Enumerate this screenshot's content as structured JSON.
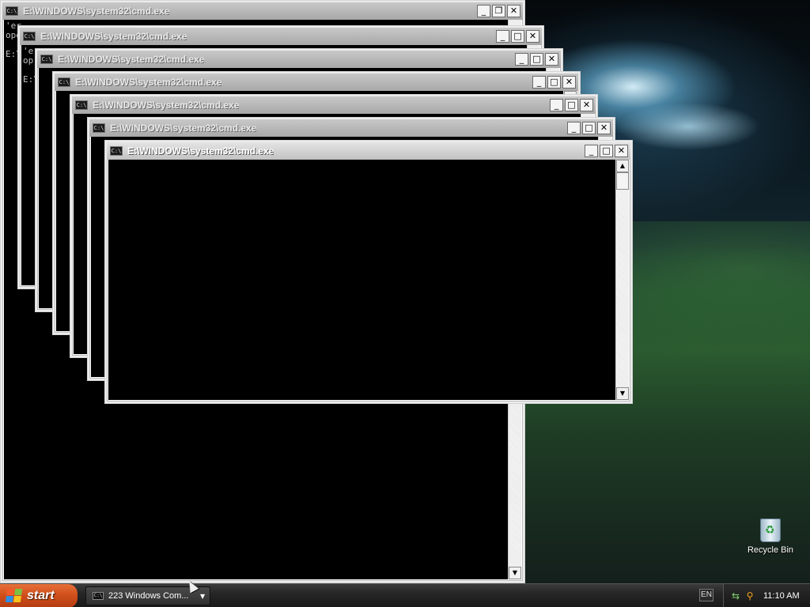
{
  "windows": [
    {
      "title": "E:\\WINDOWS\\system32\\cmd.exe",
      "console_text": "'er\nope\n\nE:\\"
    },
    {
      "title": "E:\\WINDOWS\\system32\\cmd.exe",
      "console_text": "'e\nop\n\nE:\\Do"
    },
    {
      "title": "E:\\WINDOWS\\system32\\cmd.exe",
      "console_text": ""
    },
    {
      "title": "E:\\WINDOWS\\system32\\cmd.exe",
      "console_text": ""
    },
    {
      "title": "E:\\WINDOWS\\system32\\cmd.exe",
      "console_text": ""
    },
    {
      "title": "E:\\WINDOWS\\system32\\cmd.exe",
      "console_text": ""
    },
    {
      "title": "E:\\WINDOWS\\system32\\cmd.exe",
      "console_text": ""
    }
  ],
  "window_controls": {
    "minimize": "_",
    "maximize": "□",
    "restore": "❐",
    "close": "✕",
    "scroll_up": "▲",
    "scroll_down": "▼"
  },
  "desktop": {
    "recycle_bin_label": "Recycle Bin"
  },
  "taskbar": {
    "start_label": "start",
    "task_button_label": "223 Windows Com...",
    "task_icon": "cmd-icon",
    "language": "EN",
    "clock": "11:10 AM"
  },
  "icons": {
    "app": "cmd-icon",
    "recycle": "recycle-bin-icon",
    "network": "network-icon",
    "search": "search-icon"
  }
}
